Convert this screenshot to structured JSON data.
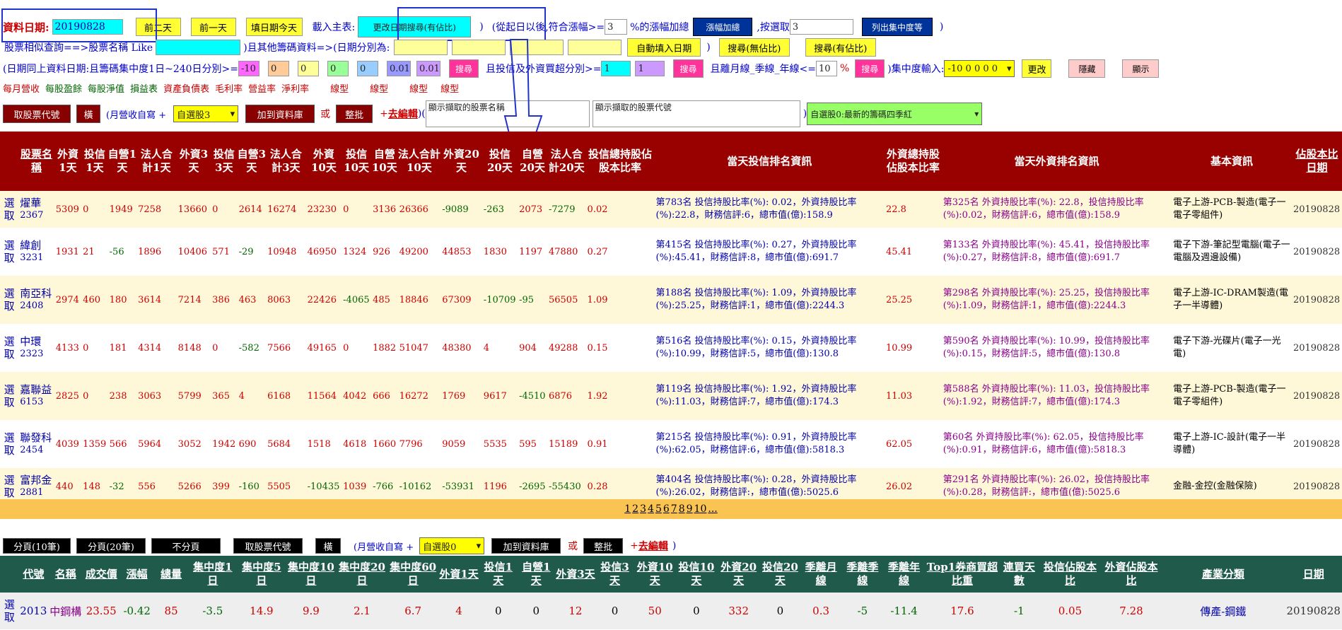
{
  "top": {
    "date_label": "資料日期:",
    "date_value": "20190828",
    "btn_prev2": "前二天",
    "btn_prev1": "前一天",
    "btn_today": "填日期今天",
    "load_label": "載入主表:",
    "btn_change_date": "更改日期搜尋(有佔比)",
    "since_text": "(從起日以後,符合漲幅>=",
    "rise_value": "3",
    "rise_text": "%的漲幅加總",
    "btn_rise_sum": "漲幅加總",
    "select_text": ",按選取",
    "select_value": "3",
    "btn_list_conc": "列出集中度等",
    "close_paren": ")"
  },
  "row2": {
    "similar_text": "股票相似查詢==>股票名稱 Like",
    "other_text": ")且其他籌碼資料=>(日期分別為:",
    "btn_auto_date": "自動填入日期",
    "btn_search_no": "搜尋(無佔比)",
    "btn_search_yes": "搜尋(有佔比)"
  },
  "row3": {
    "text1": "(日期同上資料日期:且籌碼集中度1日~240日分別>=",
    "c1": "-10",
    "c2": "0",
    "c3": "0",
    "c4": "0",
    "c5": "0",
    "c6": "0.01",
    "c7": "0.01",
    "btn_search": "搜尋",
    "text2": "且投信及外資買超分別>=",
    "v1": "1",
    "v2": "1",
    "btn_search2": "搜尋",
    "text3": "且離月線_季線_年線<=",
    "v3": "10",
    "pct": "%",
    "btn_search3": "搜尋",
    "text4": ")集中度輸入:",
    "conc_select": "-10 0 0 0 0",
    "btn_change": "更改",
    "btn_hide": "隱藏",
    "btn_show": "顯示"
  },
  "links": [
    "每月營收",
    "每股盈餘",
    "每股淨值",
    "損益表",
    "資產負債表",
    "毛利率",
    "營益率",
    "淨利率",
    "線型",
    "線型",
    "線型",
    "線型"
  ],
  "toolbar1": {
    "btn_fetch": "取股票代號",
    "btn_horizontal": "橫",
    "month_rev_text": "(月營收自寫 +",
    "sel_custom": "自選股3",
    "btn_add_db": "加到資料庫",
    "or_text": "或",
    "btn_batch": "整批",
    "plus": "+",
    "edit": "去編輯",
    "paren": ")(",
    "name_area": "顯示擷取的股票名稱",
    "code_area": "顯示擷取的股票代號",
    "close": ")",
    "sel_group": "自選股0:最新的籌碼四季紅"
  },
  "table1": {
    "headers": [
      "",
      "股票名稱",
      "外資1天",
      "投信1天",
      "自營1天",
      "法人合計1天",
      "外資3天",
      "投信3天",
      "自營3天",
      "法人合計3天",
      "外資10天",
      "投信10天",
      "自營10天",
      "法人合計10天",
      "外資20天",
      "投信20天",
      "自營20天",
      "法人合計20天",
      "投信總持股佔股本比率",
      "當天投信排名資訊",
      "外資總持股佔股本比率",
      "當天外資排名資訊",
      "基本資訊",
      "佔股本比日期"
    ],
    "rows": [
      {
        "sel": "選取",
        "name": "燿華",
        "code": "2367",
        "v": [
          "5309",
          "0",
          "1949",
          "7258",
          "13660",
          "0",
          "2614",
          "16274",
          "23230",
          "0",
          "3136",
          "26366",
          "-9089",
          "-263",
          "2073",
          "-7279"
        ],
        "tr": "0.02",
        "ti": "第783名 投信持股比率(%): 0.02，外資持股比率(%):22.8，財務信評:6，總市值(億):158.9",
        "fr": "22.8",
        "fi": "第325名 外資持股比率(%): 22.8，投信持股比率(%):0.02，財務信評:6，總市值(億):158.9",
        "basic": "電子上游-PCB-製造(電子一電子零組件)",
        "date": "20190828"
      },
      {
        "sel": "選取",
        "name": "緯創",
        "code": "3231",
        "v": [
          "1931",
          "21",
          "-56",
          "1896",
          "10406",
          "571",
          "-29",
          "10948",
          "46950",
          "1324",
          "926",
          "49200",
          "44853",
          "1830",
          "1197",
          "47880"
        ],
        "tr": "0.27",
        "ti": "第415名 投信持股比率(%): 0.27，外資持股比率(%):45.41，財務信評:8，總市值(億):691.7",
        "fr": "45.41",
        "fi": "第133名 外資持股比率(%): 45.41，投信持股比率(%):0.27，財務信評:8，總市值(億):691.7",
        "basic": "電子下游-筆記型電腦(電子一電腦及週邊設備)",
        "date": "20190828"
      },
      {
        "sel": "選取",
        "name": "南亞科",
        "code": "2408",
        "v": [
          "2974",
          "460",
          "180",
          "3614",
          "7214",
          "386",
          "463",
          "8063",
          "22426",
          "-4065",
          "485",
          "18846",
          "67309",
          "-10709",
          "-95",
          "56505"
        ],
        "tr": "1.09",
        "ti": "第188名 投信持股比率(%): 1.09，外資持股比率(%):25.25，財務信評:1，總市值(億):2244.3",
        "fr": "25.25",
        "fi": "第298名 外資持股比率(%): 25.25，投信持股比率(%):1.09，財務信評:1，總市值(億):2244.3",
        "basic": "電子上游-IC-DRAM製造(電子一半導體)",
        "date": "20190828"
      },
      {
        "sel": "選取",
        "name": "中環",
        "code": "2323",
        "v": [
          "4133",
          "0",
          "181",
          "4314",
          "8148",
          "0",
          "-582",
          "7566",
          "49165",
          "0",
          "1882",
          "51047",
          "48380",
          "4",
          "904",
          "49288"
        ],
        "tr": "0.15",
        "ti": "第516名 投信持股比率(%): 0.15，外資持股比率(%):10.99，財務信評:5，總市值(億):130.8",
        "fr": "10.99",
        "fi": "第590名 外資持股比率(%): 10.99，投信持股比率(%):0.15，財務信評:5，總市值(億):130.8",
        "basic": "電子下游-光碟片(電子一光電)",
        "date": "20190828"
      },
      {
        "sel": "選取",
        "name": "嘉聯益",
        "code": "6153",
        "v": [
          "2825",
          "0",
          "238",
          "3063",
          "5799",
          "365",
          "4",
          "6168",
          "11564",
          "4042",
          "666",
          "16272",
          "1769",
          "9617",
          "-4510",
          "6876"
        ],
        "tr": "1.92",
        "ti": "第119名 投信持股比率(%): 1.92，外資持股比率(%):11.03，財務信評:7，總市值(億):174.3",
        "fr": "11.03",
        "fi": "第588名 外資持股比率(%): 11.03，投信持股比率(%):1.92，財務信評:7，總市值(億):174.3",
        "basic": "電子上游-PCB-製造(電子一電子零組件)",
        "date": "20190828"
      },
      {
        "sel": "選取",
        "name": "聯發科",
        "code": "2454",
        "v": [
          "4039",
          "1359",
          "566",
          "5964",
          "3052",
          "1942",
          "690",
          "5684",
          "1518",
          "4618",
          "1660",
          "7796",
          "9059",
          "5535",
          "595",
          "15189"
        ],
        "tr": "0.91",
        "ti": "第215名 投信持股比率(%): 0.91，外資持股比率(%):62.05，財務信評:6，總市值(億):5818.3",
        "fr": "62.05",
        "fi": "第60名 外資持股比率(%): 62.05，投信持股比率(%):0.91，財務信評:6，總市值(億):5818.3",
        "basic": "電子上游-IC-設計(電子一半導體)",
        "date": "20190828"
      },
      {
        "sel": "選取",
        "name": "富邦金",
        "code": "2881",
        "v": [
          "440",
          "148",
          "-32",
          "556",
          "5266",
          "399",
          "-160",
          "5505",
          "-10435",
          "1039",
          "-766",
          "-10162",
          "-53931",
          "1196",
          "-2695",
          "-55430"
        ],
        "tr": "0.28",
        "ti": "第404名 投信持股比率(%): 0.28，外資持股比率(%):26.02，財務信評:，總市值(億):5025.6",
        "fr": "26.02",
        "fi": "第291名 外資持股比率(%): 26.02，投信持股比率(%):0.28，財務信評:，總市值(億):5025.6",
        "basic": "金融-金控(金融保險)",
        "date": "20190828"
      }
    ]
  },
  "pager": {
    "pages": [
      "1",
      "2",
      "3",
      "4",
      "5",
      "6",
      "7",
      "8",
      "9",
      "10",
      "..."
    ]
  },
  "toolbar2": {
    "btn_page10": "分頁(10筆)",
    "btn_page20": "分頁(20筆)",
    "btn_nopage": "不分頁",
    "btn_fetch": "取股票代號",
    "btn_horizontal": "橫",
    "month_rev_text": "(月營收自寫 +",
    "sel_custom": "自選股0",
    "btn_add_db": "加到資料庫",
    "or_text": "或",
    "btn_batch": "整批",
    "plus": "+",
    "edit": "去編輯",
    "close": ")"
  },
  "table2": {
    "headers": [
      "代號",
      "名稱",
      "成交價",
      "漲幅",
      "總量",
      "集中度1日",
      "集中度5日",
      "集中度10日",
      "集中度20日",
      "集中度60日",
      "外資1天",
      "投信1天",
      "自營1天",
      "外資3天",
      "投信3天",
      "外資10天",
      "投信10天",
      "外資20天",
      "投信20天",
      "季離月線",
      "季離季線",
      "季離年線",
      "Top1券商買超比重",
      "連買天數",
      "投信佔股本比",
      "外資佔股本比",
      "產業分類",
      "日期"
    ],
    "row": {
      "sel": "選取",
      "cells": [
        "2013",
        "中鋼構",
        "23.55",
        "-0.42",
        "85",
        "-3.5",
        "14.9",
        "9.9",
        "2.1",
        "6.7",
        "4",
        "0",
        "0",
        "12",
        "0",
        "50",
        "0",
        "332",
        "0",
        "0.3",
        "-5",
        "-11.4",
        "17.6",
        "-1",
        "0.05",
        "7.28",
        "傳產-鋼鐵",
        "20190828"
      ]
    }
  }
}
